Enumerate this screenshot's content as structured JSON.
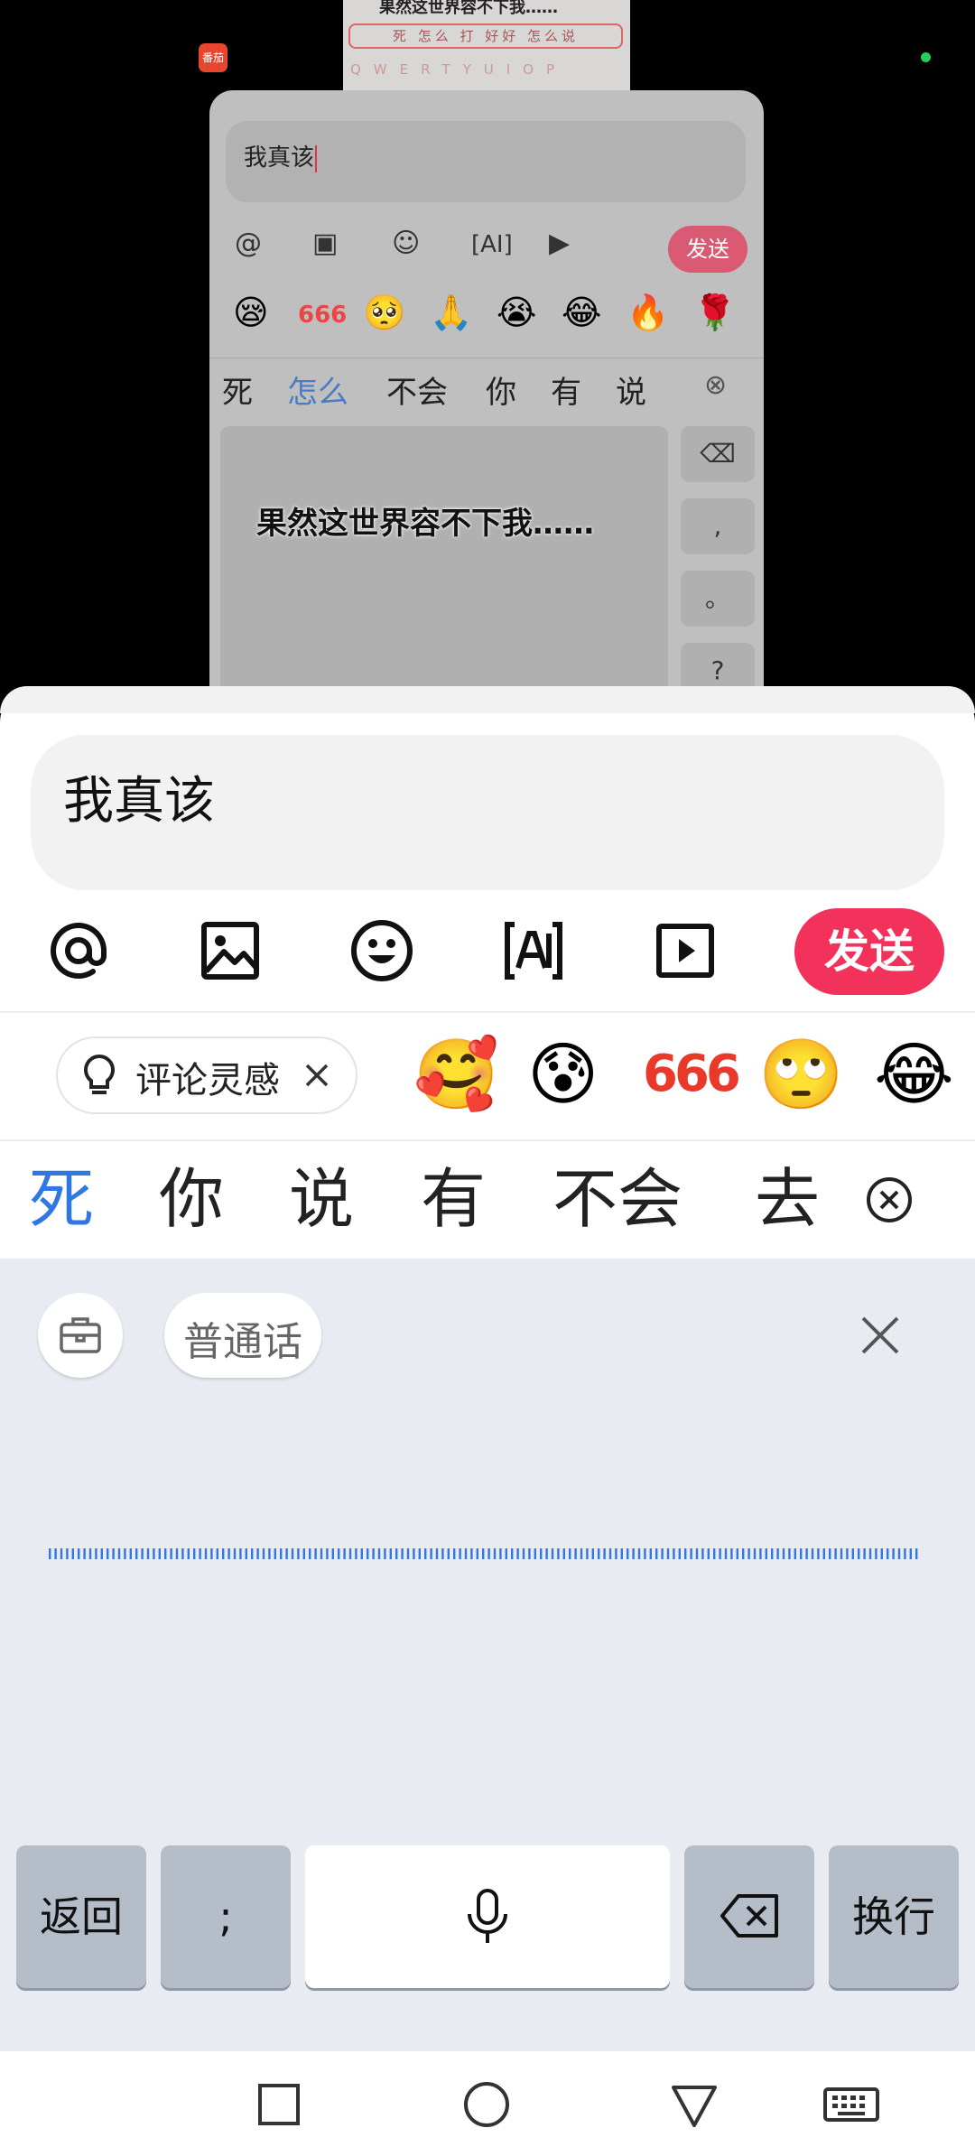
{
  "background_video": {
    "caption": "果然这世界容不下我……",
    "mini_caption": "果然这世界容不下我……",
    "mini_candidates": "死 怎么 打 好好 怎么说",
    "mini_keys": "QWERTYUIOP",
    "app_badge_text": "番茄"
  },
  "inner_panel": {
    "input_text": "我真该",
    "send_label": "发送",
    "emojis": [
      "😪",
      "666",
      "🥺",
      "🙏",
      "😭",
      "😂",
      "🔥",
      "🌹"
    ],
    "candidates": [
      "死",
      "怎么",
      "不会",
      "你",
      "有",
      "说"
    ],
    "side_keys": [
      ",",
      "。",
      "?"
    ]
  },
  "comment": {
    "input_text": "我真该",
    "send_label": "发送",
    "tools": [
      "at-icon",
      "image-icon",
      "emoji-icon",
      "ai-text-icon",
      "video-icon"
    ]
  },
  "suggestions": {
    "inspiration_label": "评论灵感",
    "emojis": [
      "🥰",
      "😰",
      "666",
      "🙄",
      "😂"
    ]
  },
  "candidates": {
    "items": [
      "死",
      "你",
      "说",
      "有",
      "不会",
      "去"
    ]
  },
  "keyboard": {
    "mode_label": "普通话",
    "back_label": "返回",
    "semicolon_label": ";",
    "enter_label": "换行"
  },
  "colors": {
    "send": "#f2325a",
    "candidate_active": "#2f77e3",
    "keyboard_bg": "#e8ecf2",
    "waveform": "#2f77e3"
  }
}
